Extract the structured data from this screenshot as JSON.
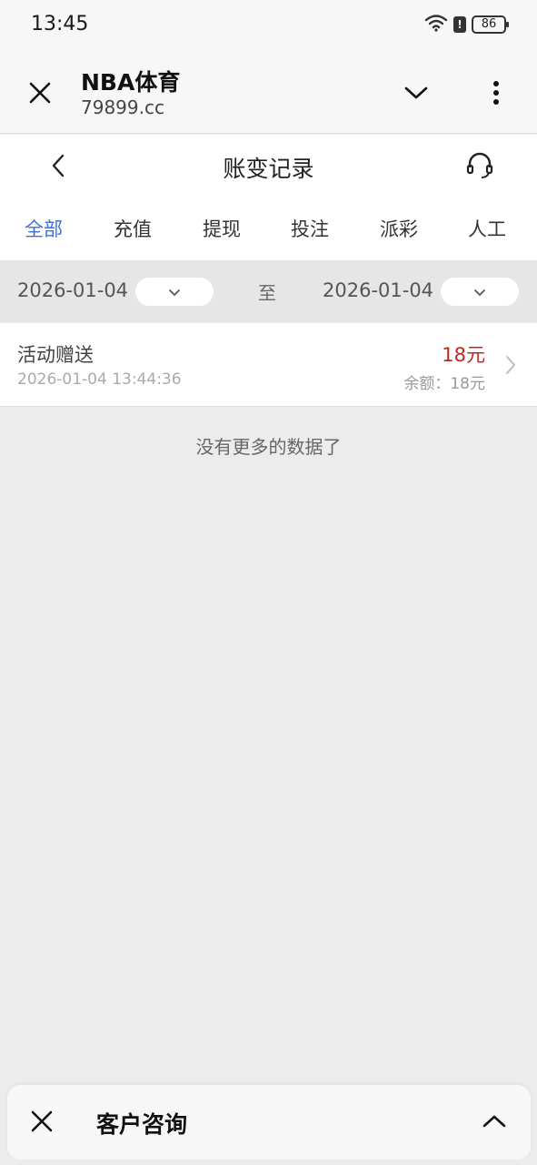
{
  "status_bar": {
    "time": "13:45",
    "battery": "86",
    "icons": [
      "wifi-icon",
      "alert-icon",
      "battery-icon"
    ]
  },
  "browser": {
    "title": "NBA体育",
    "url": "79899.cc",
    "icons": [
      "close-icon",
      "chevron-down-icon",
      "more-vertical-icon"
    ]
  },
  "page": {
    "title": "账变记录",
    "icons": [
      "back-icon",
      "headset-icon"
    ]
  },
  "tabs": [
    {
      "label": "全部",
      "active": true
    },
    {
      "label": "充值",
      "active": false
    },
    {
      "label": "提现",
      "active": false
    },
    {
      "label": "投注",
      "active": false
    },
    {
      "label": "派彩",
      "active": false
    },
    {
      "label": "人工",
      "active": false
    }
  ],
  "filter": {
    "start_date": "2026-01-04",
    "separator": "至",
    "end_date": "2026-01-04"
  },
  "records": [
    {
      "title": "活动赠送",
      "time": "2026-01-04 13:44:36",
      "amount": "18元",
      "balance": "余额：18元"
    }
  ],
  "list_end_text": "没有更多的数据了",
  "bottom_panel": {
    "title": "客户咨询",
    "icons": [
      "close-icon",
      "chevron-up-icon"
    ]
  },
  "colors": {
    "accent": "#3d6fd6",
    "amount": "#c0271f",
    "background": "#ececec"
  }
}
